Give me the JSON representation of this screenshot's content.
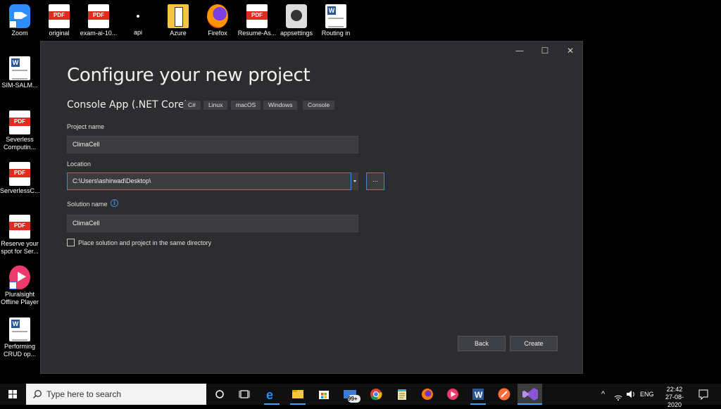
{
  "desktop": {
    "icons": [
      {
        "label": "Zoom",
        "icon": "zoom-icon"
      },
      {
        "label": "original",
        "icon": "pdf-icon"
      },
      {
        "label": "exam-ai-10...",
        "icon": "pdf-icon"
      },
      {
        "label": "api",
        "icon": "file-icon"
      },
      {
        "label": "Azure",
        "icon": "folder-icon"
      },
      {
        "label": "Firefox",
        "icon": "firefox-icon"
      },
      {
        "label": "Resume-As...",
        "icon": "pdf-icon"
      },
      {
        "label": "appsettings",
        "icon": "settings-file-icon"
      },
      {
        "label": "Routing in",
        "icon": "word-icon"
      },
      {
        "label": "SIM-SALM...",
        "icon": "word-icon"
      },
      {
        "label": "Severless Computin...",
        "icon": "pdf-icon"
      },
      {
        "label": "ServerlessC...",
        "icon": "pdf-icon"
      },
      {
        "label": "Reserve your spot for Ser...",
        "icon": "pdf-icon"
      },
      {
        "label": "Pluralsight Offline Player",
        "icon": "pluralsight-icon"
      },
      {
        "label": "Performing CRUD op...",
        "icon": "word-icon"
      }
    ]
  },
  "dialog": {
    "window_controls": {
      "minimize": "—",
      "maximize": "☐",
      "close": "✕"
    },
    "title": "Configure your new project",
    "template_name": "Console App (.NET Core)",
    "tags": [
      "C#",
      "Linux",
      "macOS",
      "Windows",
      "Console"
    ],
    "project_name": {
      "label": "Project name",
      "value": "ClimaCell"
    },
    "location": {
      "label": "Location",
      "value": "C:\\Users\\ashirwad\\Desktop\\",
      "browse_label": "..."
    },
    "solution_name": {
      "label": "Solution name",
      "value": "ClimaCell",
      "info_glyph": "i"
    },
    "same_directory": {
      "label": "Place solution and project in the same directory",
      "checked": false
    },
    "buttons": {
      "back": "Back",
      "create": "Create"
    }
  },
  "taskbar": {
    "search_placeholder": "Type here to search",
    "badge": "99+",
    "apps": [
      "task-view-icon",
      "edge-icon",
      "file-explorer-icon",
      "store-icon",
      "mail-icon",
      "chrome-icon",
      "notepad-icon",
      "firefox-icon",
      "pluralsight-icon",
      "word-icon",
      "postman-icon",
      "visual-studio-icon"
    ],
    "language": "ENG",
    "time": "22:42",
    "date": "27-08-2020"
  },
  "colors": {
    "accent": "#3f8ad8",
    "dialog_bg": "#2d2d30",
    "field_bg": "#3c3c3f"
  }
}
